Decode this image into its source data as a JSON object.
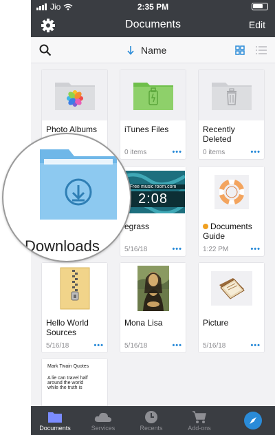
{
  "status_bar": {
    "carrier": "Jio",
    "time": "2:35 PM"
  },
  "nav": {
    "title": "Documents",
    "edit_label": "Edit"
  },
  "sort": {
    "label": "Name"
  },
  "items": [
    {
      "name": "Photo Albums",
      "meta": "",
      "icon": "photos-folder-icon"
    },
    {
      "name": "iTunes Files",
      "meta": "0 items",
      "icon": "usb-folder-icon"
    },
    {
      "name": "Recently Deleted",
      "meta": "0 items",
      "icon": "trash-folder-icon"
    },
    {
      "name": "Bluegrass",
      "partial_name": "egrass",
      "meta": "5/16/18",
      "thumb_text": "2:08",
      "thumb_banner": "Free music room.com",
      "icon": "video-thumbnail"
    },
    {
      "name": "Documents Guide",
      "meta": "1:22 PM",
      "icon": "lifebuoy-icon"
    },
    {
      "name": "Hello World Sources",
      "meta": "5/16/18",
      "icon": "zip-archive-icon"
    },
    {
      "name": "Mona Lisa",
      "meta": "5/16/18",
      "icon": "mona-lisa-image"
    },
    {
      "name": "Picture",
      "meta": "5/16/18",
      "icon": "picture-file-icon"
    },
    {
      "name": "Mark Twain Quotes",
      "thumb_lines": [
        "Mark Twain Quotes",
        "A lie can travel half",
        "around the world",
        "while the truth is"
      ],
      "icon": "text-document-thumbnail"
    }
  ],
  "magnifier": {
    "label": "Downloads"
  },
  "tabs": [
    {
      "label": "Documents",
      "active": true
    },
    {
      "label": "Services",
      "active": false
    },
    {
      "label": "Recents",
      "active": false
    },
    {
      "label": "Add-ons",
      "active": false
    }
  ],
  "colors": {
    "accent": "#2a8bd8",
    "bar": "#3a3d42",
    "folder_green": "#8ed06a",
    "folder_blue": "#8dc9f0"
  }
}
